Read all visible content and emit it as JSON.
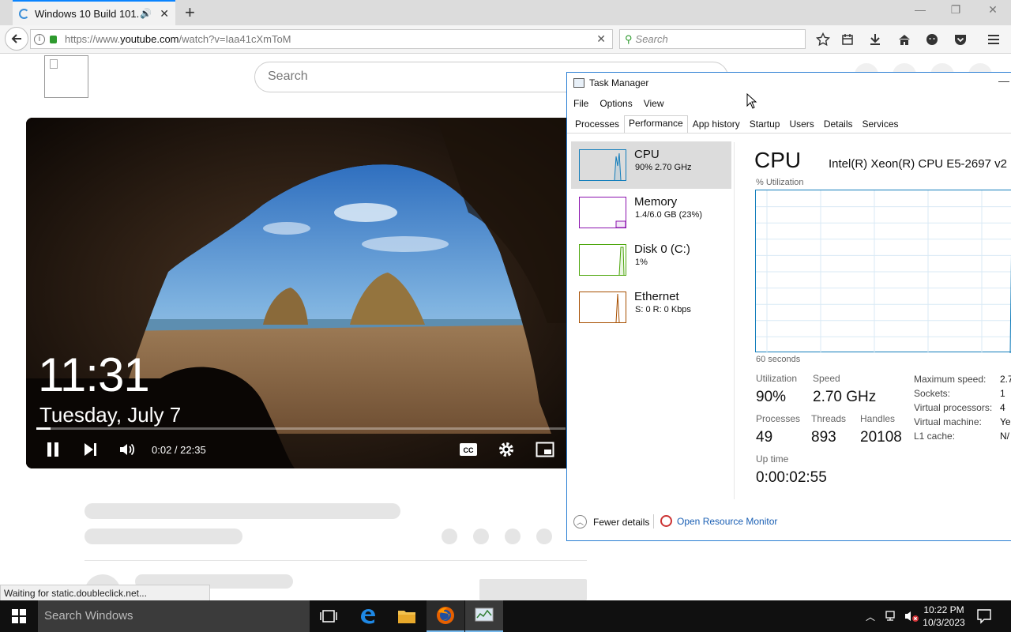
{
  "browser": {
    "tab_title": "Windows 10 Build 101...",
    "new_tab_symbol": "+",
    "url_prefix": "https://www.",
    "url_domain": "youtube.com",
    "url_path": "/watch?v=Iaa41cXmToM",
    "search_placeholder": "Search",
    "status_text": "Waiting for static.doubleclick.net..."
  },
  "youtube": {
    "search_placeholder": "Search",
    "video": {
      "clock": "11:31",
      "date": "Tuesday, July 7",
      "time_display": "0:02 / 22:35",
      "progress_fraction": 0.0015
    }
  },
  "task_manager": {
    "title": "Task Manager",
    "menu": [
      "File",
      "Options",
      "View"
    ],
    "tabs": [
      "Processes",
      "Performance",
      "App history",
      "Startup",
      "Users",
      "Details",
      "Services"
    ],
    "active_tab": "Performance",
    "resources": [
      {
        "name": "CPU",
        "sub": "90% 2.70 GHz",
        "color": "#117dbb"
      },
      {
        "name": "Memory",
        "sub": "1.4/6.0 GB (23%)",
        "color": "#8b12ae"
      },
      {
        "name": "Disk 0 (C:)",
        "sub": "1%",
        "color": "#4da60c"
      },
      {
        "name": "Ethernet",
        "sub": "S: 0 R: 0 Kbps",
        "color": "#a74f01"
      }
    ],
    "cpu": {
      "heading": "CPU",
      "model": "Intel(R) Xeon(R) CPU E5-2697 v2",
      "util_label": "% Utilization",
      "seconds_label": "60 seconds",
      "utilization_label": "Utilization",
      "utilization": "90%",
      "speed_label": "Speed",
      "speed": "2.70 GHz",
      "processes_label": "Processes",
      "processes": "49",
      "threads_label": "Threads",
      "threads": "893",
      "handles_label": "Handles",
      "handles": "20108",
      "uptime_label": "Up time",
      "uptime": "0:00:02:55",
      "details": [
        {
          "k": "Maximum speed:",
          "v": "2.7"
        },
        {
          "k": "Sockets:",
          "v": "1"
        },
        {
          "k": "Virtual processors:",
          "v": "4"
        },
        {
          "k": "Virtual machine:",
          "v": "Yes"
        },
        {
          "k": "L1 cache:",
          "v": "N/"
        }
      ]
    },
    "fewer_details": "Fewer details",
    "open_resource_monitor": "Open Resource Monitor"
  },
  "taskbar": {
    "search_placeholder": "Search Windows",
    "time": "10:22 PM",
    "date": "10/3/2023"
  }
}
